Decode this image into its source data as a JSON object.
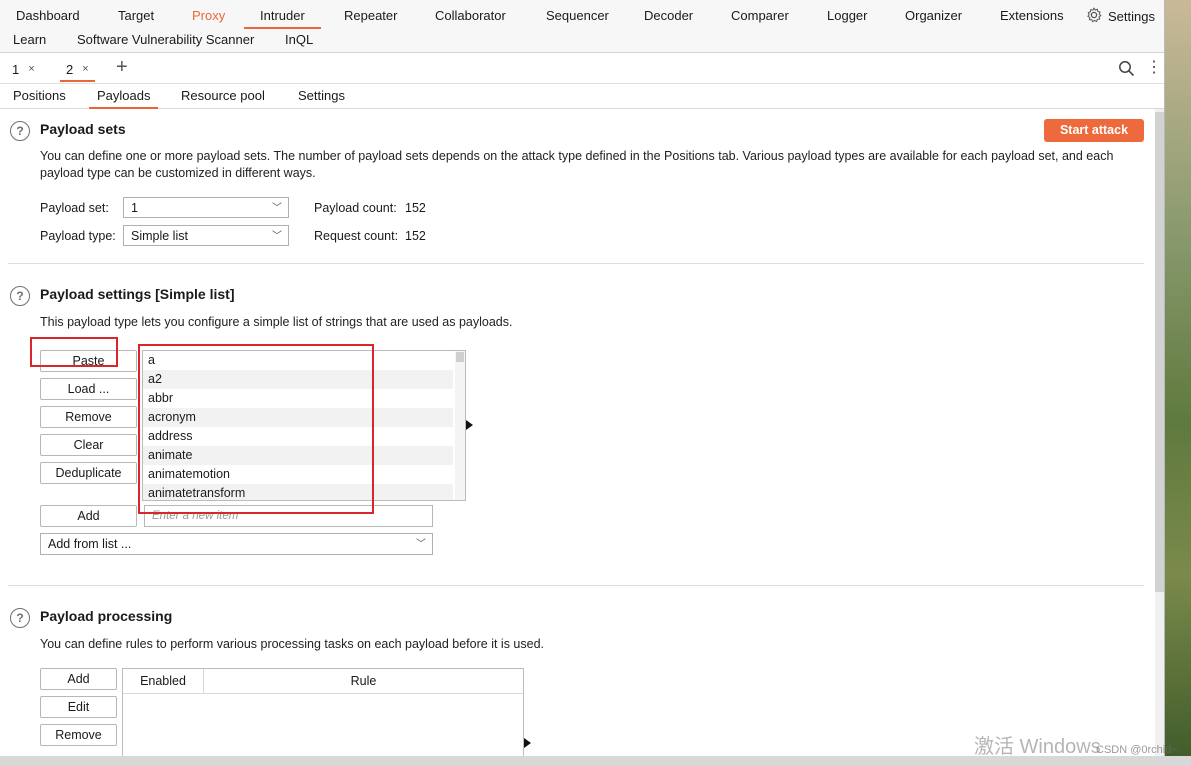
{
  "nav": {
    "row1": [
      "Dashboard",
      "Target",
      "Proxy",
      "Intruder",
      "Repeater",
      "Collaborator",
      "Sequencer",
      "Decoder",
      "Comparer",
      "Logger",
      "Organizer",
      "Extensions"
    ],
    "settings": "Settings",
    "row2": [
      "Learn",
      "Software Vulnerability Scanner",
      "InQL"
    ]
  },
  "intruder_tabs": [
    {
      "label": "1",
      "close": "×"
    },
    {
      "label": "2",
      "close": "×"
    }
  ],
  "add_tab": "+",
  "payload_tabs": [
    "Positions",
    "Payloads",
    "Resource pool",
    "Settings"
  ],
  "payload_sets": {
    "title": "Payload sets",
    "start_attack": "Start attack",
    "description": "You can define one or more payload sets. The number of payload sets depends on the attack type defined in the Positions tab. Various payload types are available for each payload set, and each payload type can be customized in different ways.",
    "payload_set_label": "Payload set:",
    "payload_set_value": "1",
    "payload_type_label": "Payload type:",
    "payload_type_value": "Simple list",
    "payload_count_label": "Payload count:",
    "payload_count": "152",
    "request_count_label": "Request count:",
    "request_count": "152"
  },
  "payload_settings": {
    "title": "Payload settings [Simple list]",
    "description": "This payload type lets you configure a simple list of strings that are used as payloads.",
    "buttons": [
      "Paste",
      "Load ...",
      "Remove",
      "Clear",
      "Deduplicate"
    ],
    "list_items": [
      "a",
      "a2",
      "abbr",
      "acronym",
      "address",
      "animate",
      "animatemotion",
      "animatetransform"
    ],
    "add_button": "Add",
    "new_item_placeholder": "Enter a new item",
    "add_from_list": "Add from list ..."
  },
  "payload_processing": {
    "title": "Payload processing",
    "description": "You can define rules to perform various processing tasks on each payload before it is used.",
    "buttons": [
      "Add",
      "Edit",
      "Remove"
    ],
    "columns": [
      "Enabled",
      "Rule"
    ]
  },
  "watermark": {
    "activate": "激活 Windows",
    "csdn": "CSDN @0rchid~"
  },
  "colors": {
    "accent": "#ee6a3c",
    "annotation": "#d9262c"
  }
}
